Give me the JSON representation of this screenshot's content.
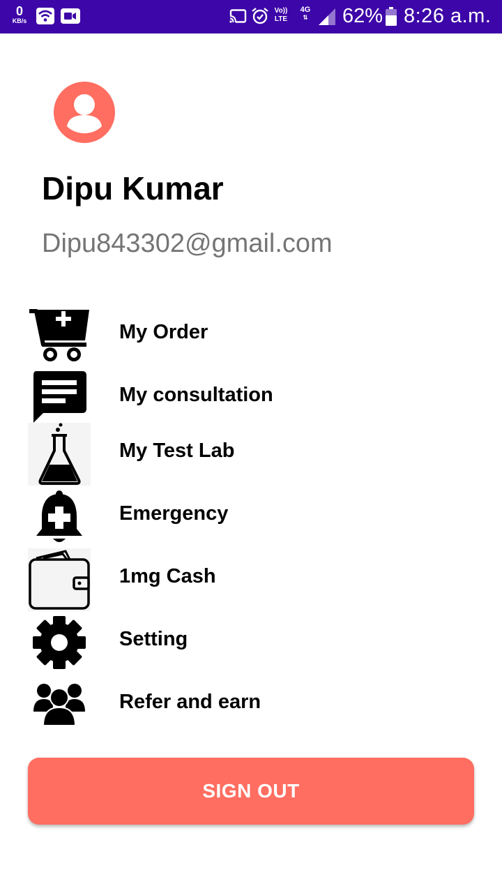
{
  "status_bar": {
    "data_speed": "0",
    "data_unit": "KB/s",
    "volte": [
      "Vo))",
      "LTE"
    ],
    "network": "4G",
    "battery_percent": "62%",
    "time": "8:26 a.m.",
    "background_color": "#3d06a8"
  },
  "profile": {
    "name": "Dipu Kumar",
    "email": "Dipu843302@gmail.com",
    "avatar_icon": "account-circle-icon",
    "avatar_color": "#ff6e61"
  },
  "menu": {
    "items": [
      {
        "label": "My Order",
        "icon": "medical-cart-icon"
      },
      {
        "label": "My consultation",
        "icon": "chat-bubble-icon"
      },
      {
        "label": "My Test Lab",
        "icon": "lab-flask-icon"
      },
      {
        "label": "Emergency",
        "icon": "emergency-bell-icon"
      },
      {
        "label": "1mg Cash",
        "icon": "wallet-icon"
      },
      {
        "label": "Setting",
        "icon": "gear-icon"
      },
      {
        "label": "Refer and earn",
        "icon": "group-icon"
      }
    ]
  },
  "actions": {
    "sign_out_label": "SIGN OUT",
    "sign_out_color": "#ff6e61"
  }
}
